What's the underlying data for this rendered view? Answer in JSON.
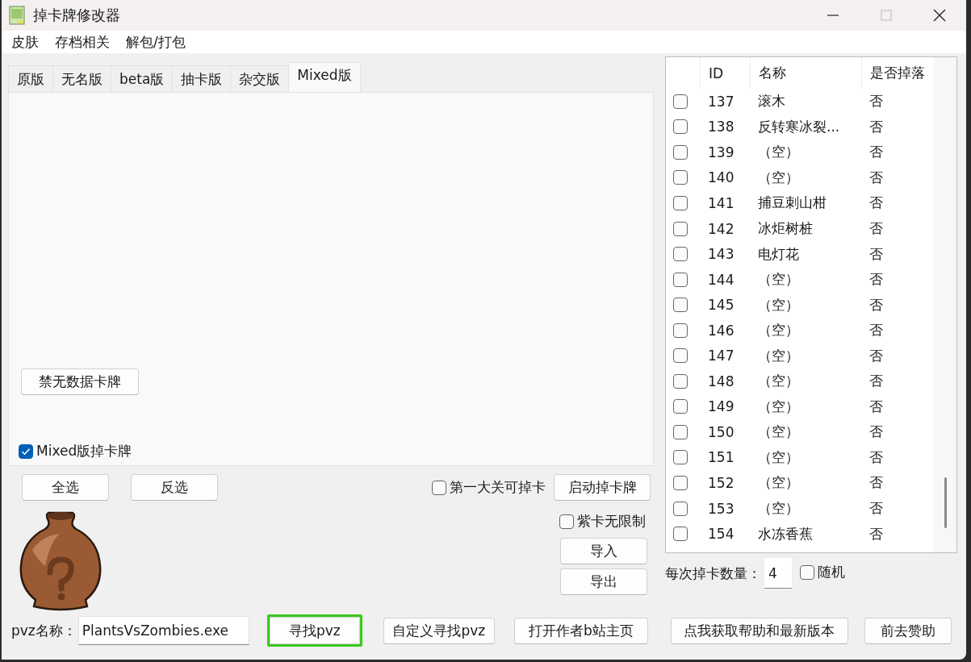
{
  "window": {
    "title": "掉卡牌修改器",
    "controls": [
      {
        "kind": "minimize",
        "disabled": false
      },
      {
        "kind": "maximize",
        "disabled": true
      },
      {
        "kind": "close",
        "disabled": false
      }
    ]
  },
  "menu": [
    "皮肤",
    "存档相关",
    "解包/打包"
  ],
  "tabs": [
    {
      "label": "原版",
      "selected": false
    },
    {
      "label": "无名版",
      "selected": false
    },
    {
      "label": "beta版",
      "selected": false
    },
    {
      "label": "抽卡版",
      "selected": false
    },
    {
      "label": "杂交版",
      "selected": false
    },
    {
      "label": "Mixed版",
      "selected": true
    }
  ],
  "tab_panel": {
    "button": "禁无数据卡牌",
    "checkbox": {
      "label": "Mixed版掉卡牌",
      "checked": true
    }
  },
  "select_buttons": [
    "全选",
    "反选"
  ],
  "first_level_option": {
    "label": "第一大关可掉卡",
    "checked": false
  },
  "start_button": "启动掉卡牌",
  "purple_option": {
    "label": "紫卡无限制",
    "checked": false
  },
  "file_buttons": [
    "导入",
    "导出"
  ],
  "card_table": {
    "columns": [
      "ID",
      "名称",
      "是否掉落"
    ],
    "rows": [
      {
        "checked": false,
        "id": "137",
        "name": "滚木",
        "drop": "否"
      },
      {
        "checked": false,
        "id": "138",
        "name": "反转寒冰裂...",
        "drop": "否"
      },
      {
        "checked": false,
        "id": "139",
        "name": "（空）",
        "drop": "否"
      },
      {
        "checked": false,
        "id": "140",
        "name": "（空）",
        "drop": "否"
      },
      {
        "checked": false,
        "id": "141",
        "name": "捕豆刺山柑",
        "drop": "否"
      },
      {
        "checked": false,
        "id": "142",
        "name": "冰炬树桩",
        "drop": "否"
      },
      {
        "checked": false,
        "id": "143",
        "name": "电灯花",
        "drop": "否"
      },
      {
        "checked": false,
        "id": "144",
        "name": "（空）",
        "drop": "否"
      },
      {
        "checked": false,
        "id": "145",
        "name": "（空）",
        "drop": "否"
      },
      {
        "checked": false,
        "id": "146",
        "name": "（空）",
        "drop": "否"
      },
      {
        "checked": false,
        "id": "147",
        "name": "（空）",
        "drop": "否"
      },
      {
        "checked": false,
        "id": "148",
        "name": "（空）",
        "drop": "否"
      },
      {
        "checked": false,
        "id": "149",
        "name": "（空）",
        "drop": "否"
      },
      {
        "checked": false,
        "id": "150",
        "name": "（空）",
        "drop": "否"
      },
      {
        "checked": false,
        "id": "151",
        "name": "（空）",
        "drop": "否"
      },
      {
        "checked": false,
        "id": "152",
        "name": "（空）",
        "drop": "否"
      },
      {
        "checked": false,
        "id": "153",
        "name": "（空）",
        "drop": "否"
      },
      {
        "checked": false,
        "id": "154",
        "name": "水冻香蕉",
        "drop": "否"
      }
    ]
  },
  "drop_count": {
    "label": "每次掉卡数量：",
    "value": "4"
  },
  "random_option": {
    "label": "随机",
    "checked": false
  },
  "pvz_name": {
    "label": "pvz名称：",
    "value": "PlantsVsZombies.exe"
  },
  "bottom_buttons": [
    {
      "label": "寻找pvz",
      "highlighted": true
    },
    {
      "label": "自定义寻找pvz",
      "highlighted": false
    },
    {
      "label": "打开作者b站主页",
      "highlighted": false
    },
    {
      "label": "点我获取帮助和最新版本",
      "highlighted": false
    },
    {
      "label": "前去赞助",
      "highlighted": false
    }
  ]
}
